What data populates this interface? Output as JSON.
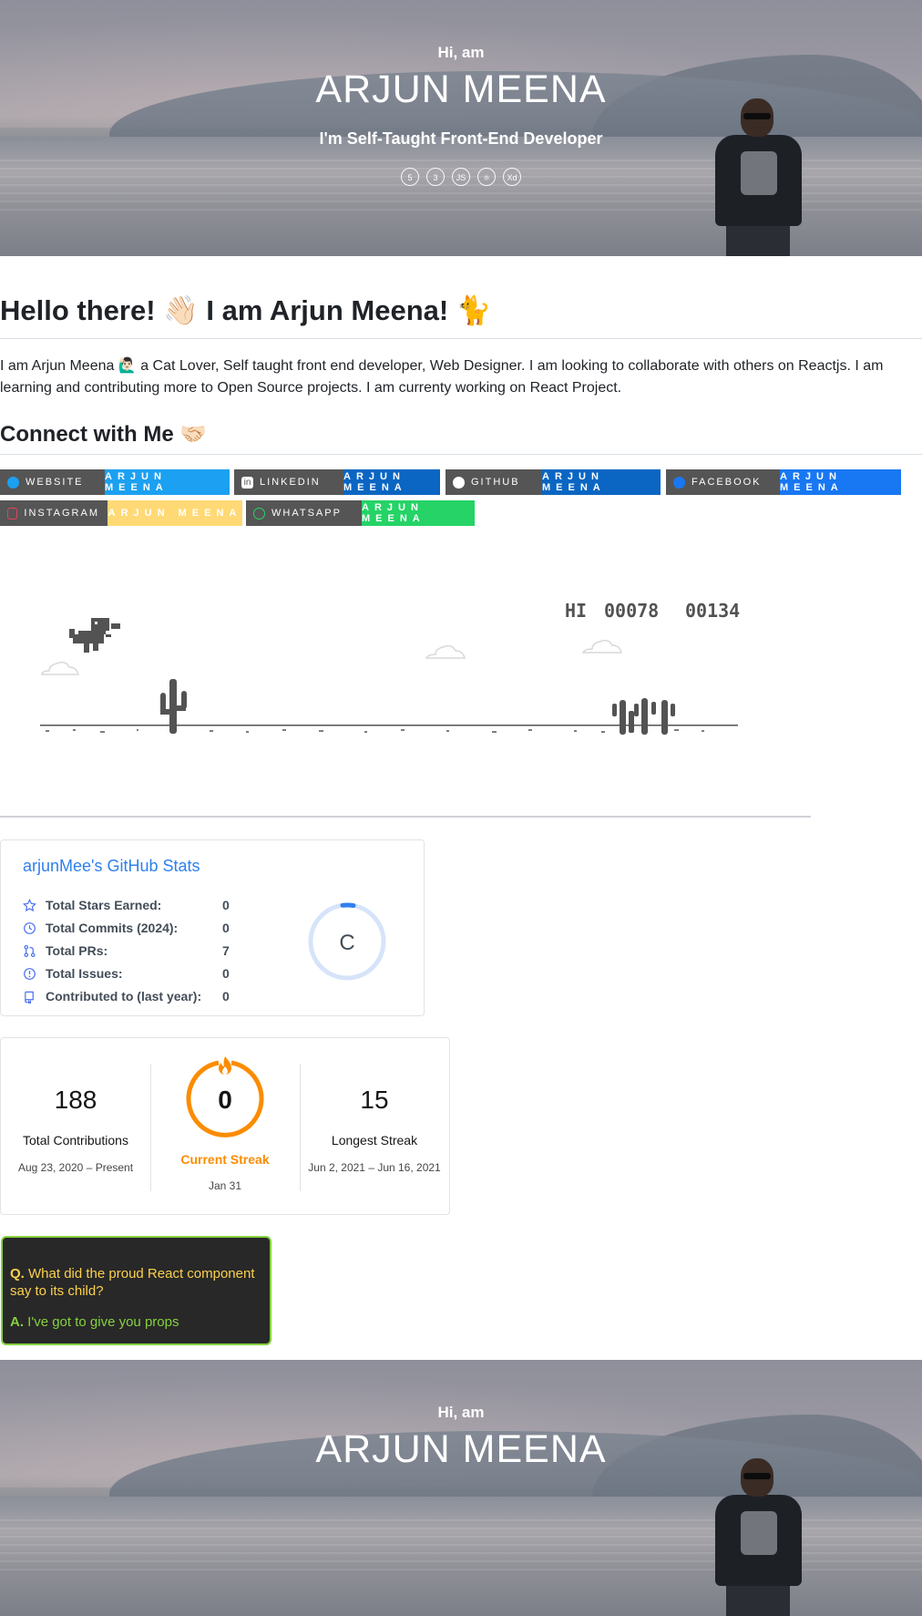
{
  "hero": {
    "greeting": "Hi, am",
    "name": "ARJUN MEENA",
    "tagline": "I'm Self-Taught Front-End Developer",
    "tech_icons": [
      "html5-icon",
      "css3-icon",
      "javascript-icon",
      "react-icon",
      "xd-icon"
    ],
    "tech_glyphs": [
      "5",
      "3",
      "JS",
      "⚛",
      "Xd"
    ]
  },
  "intro": {
    "heading": "Hello there! 👋🏻 I am Arjun Meena! 🐈",
    "body": "I am Arjun Meena 🙋🏻‍♂️ a Cat Lover, Self taught front end developer, Web Designer. I am looking to collaborate with others on Reactjs. I am learning and contributing more to Open Source projects. I am currenty working on React Project."
  },
  "connect": {
    "heading": "Connect with Me 🤝🏻",
    "badges": [
      {
        "label": "WEBSITE",
        "value": "ARJUN MEENA",
        "color": "#1ca0f1",
        "icon": "globe-icon"
      },
      {
        "label": "LINKEDIN",
        "value": "ARJUN MEENA",
        "color": "#0a66c2",
        "icon": "linkedin-icon"
      },
      {
        "label": "GITHUB",
        "value": "ARJUN MEENA",
        "color": "#0a66c2",
        "icon": "github-icon"
      },
      {
        "label": "FACEBOOK",
        "value": "ARJUN MEENA",
        "color": "#1877f2",
        "icon": "facebook-icon"
      },
      {
        "label": "INSTAGRAM",
        "value": "ARJUN MEENA",
        "color": "#ffd975",
        "icon": "instagram-icon"
      },
      {
        "label": "WHATSAPP",
        "value": "ARJUN MEENA",
        "color": "#25d366",
        "icon": "whatsapp-icon"
      }
    ]
  },
  "game": {
    "hi_score_label": "HI",
    "hi_score": "00078",
    "score": "00134"
  },
  "github_stats": {
    "title": "arjunMee's GitHub Stats",
    "rows": [
      {
        "label": "Total Stars Earned:",
        "value": "0",
        "icon": "star-icon"
      },
      {
        "label": "Total Commits (2024):",
        "value": "0",
        "icon": "history-icon"
      },
      {
        "label": "Total PRs:",
        "value": "7",
        "icon": "pull-request-icon"
      },
      {
        "label": "Total Issues:",
        "value": "0",
        "icon": "issue-icon"
      },
      {
        "label": "Contributed to (last year):",
        "value": "0",
        "icon": "repo-icon"
      }
    ],
    "rank": "C",
    "accent": "#2f80ed"
  },
  "streak": {
    "total": {
      "value": "188",
      "label": "Total Contributions",
      "range": "Aug 23, 2020 – Present"
    },
    "current": {
      "value": "0",
      "label": "Current Streak",
      "range": "Jan 31"
    },
    "longest": {
      "value": "15",
      "label": "Longest Streak",
      "range": "Jun 2, 2021 – Jun 16, 2021"
    },
    "accent": "#fb8c00"
  },
  "joke": {
    "q_prefix": "Q.",
    "question": "What did the proud React component say to its child?",
    "a_prefix": "A.",
    "answer": "I've got to give you props"
  }
}
